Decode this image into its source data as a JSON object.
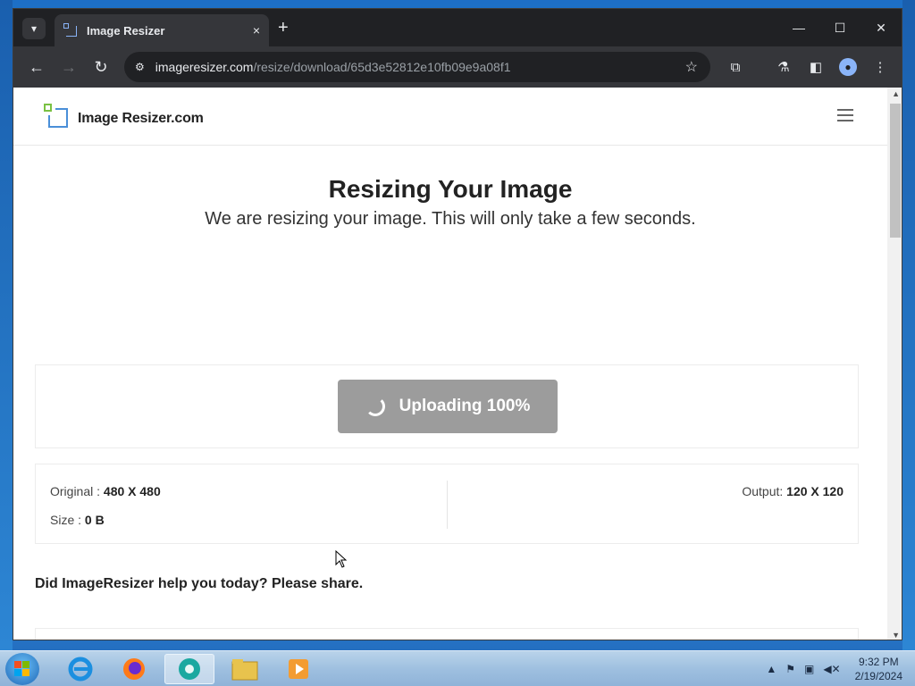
{
  "browser": {
    "tab_title": "Image Resizer",
    "tab_close": "×",
    "new_tab": "+",
    "url_host": "imageresizer.com",
    "url_path": "/resize/download/65d3e52812e10fb09e9a08f1",
    "window_controls": {
      "minimize": "—",
      "maximize": "☐",
      "close": "✕"
    }
  },
  "site": {
    "brand": "Image Resizer.com",
    "heading": "Resizing Your Image",
    "subheading": "We are resizing your image. This will only take a few seconds.",
    "upload_button": "Uploading 100%",
    "upload_progress_percent": 100,
    "original_label": "Original :",
    "original_value": "480 X 480",
    "size_label": "Size :",
    "size_value": "0 B",
    "output_label": "Output:",
    "output_value": "120 X 120",
    "share_prompt": "Did ImageResizer help you today? Please share."
  },
  "taskbar": {
    "time": "9:32 PM",
    "date": "2/19/2024"
  },
  "colors": {
    "browser_dark": "#202124",
    "toolbar": "#35363a",
    "upload_button_bg": "#9c9c9c",
    "logo_green": "#7ac142",
    "logo_blue": "#4a8fd8"
  }
}
